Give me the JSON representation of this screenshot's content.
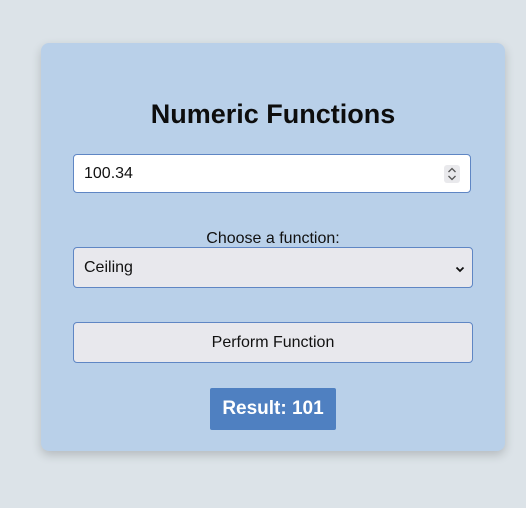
{
  "card": {
    "title": "Numeric Functions",
    "number_input": {
      "value": "100.34"
    },
    "function_label": "Choose a function:",
    "function_select": {
      "selected": "Ceiling"
    },
    "perform_button_label": "Perform Function",
    "result_text": "Result: 101"
  },
  "icons": {
    "spinner": "spinner-arrows-icon",
    "dropdown": "chevron-down-icon"
  },
  "colors": {
    "page_background": "#dce3e8",
    "card_background": "#b9d0e9",
    "border_accent": "#5f86c4",
    "result_background": "#4f80c1"
  }
}
